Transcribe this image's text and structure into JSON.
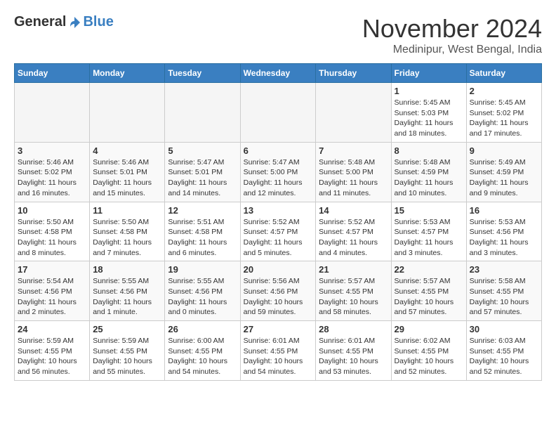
{
  "logo": {
    "general": "General",
    "blue": "Blue"
  },
  "title": "November 2024",
  "location": "Medinipur, West Bengal, India",
  "days_of_week": [
    "Sunday",
    "Monday",
    "Tuesday",
    "Wednesday",
    "Thursday",
    "Friday",
    "Saturday"
  ],
  "weeks": [
    [
      {
        "day": "",
        "info": ""
      },
      {
        "day": "",
        "info": ""
      },
      {
        "day": "",
        "info": ""
      },
      {
        "day": "",
        "info": ""
      },
      {
        "day": "",
        "info": ""
      },
      {
        "day": "1",
        "info": "Sunrise: 5:45 AM\nSunset: 5:03 PM\nDaylight: 11 hours and 18 minutes."
      },
      {
        "day": "2",
        "info": "Sunrise: 5:45 AM\nSunset: 5:02 PM\nDaylight: 11 hours and 17 minutes."
      }
    ],
    [
      {
        "day": "3",
        "info": "Sunrise: 5:46 AM\nSunset: 5:02 PM\nDaylight: 11 hours and 16 minutes."
      },
      {
        "day": "4",
        "info": "Sunrise: 5:46 AM\nSunset: 5:01 PM\nDaylight: 11 hours and 15 minutes."
      },
      {
        "day": "5",
        "info": "Sunrise: 5:47 AM\nSunset: 5:01 PM\nDaylight: 11 hours and 14 minutes."
      },
      {
        "day": "6",
        "info": "Sunrise: 5:47 AM\nSunset: 5:00 PM\nDaylight: 11 hours and 12 minutes."
      },
      {
        "day": "7",
        "info": "Sunrise: 5:48 AM\nSunset: 5:00 PM\nDaylight: 11 hours and 11 minutes."
      },
      {
        "day": "8",
        "info": "Sunrise: 5:48 AM\nSunset: 4:59 PM\nDaylight: 11 hours and 10 minutes."
      },
      {
        "day": "9",
        "info": "Sunrise: 5:49 AM\nSunset: 4:59 PM\nDaylight: 11 hours and 9 minutes."
      }
    ],
    [
      {
        "day": "10",
        "info": "Sunrise: 5:50 AM\nSunset: 4:58 PM\nDaylight: 11 hours and 8 minutes."
      },
      {
        "day": "11",
        "info": "Sunrise: 5:50 AM\nSunset: 4:58 PM\nDaylight: 11 hours and 7 minutes."
      },
      {
        "day": "12",
        "info": "Sunrise: 5:51 AM\nSunset: 4:58 PM\nDaylight: 11 hours and 6 minutes."
      },
      {
        "day": "13",
        "info": "Sunrise: 5:52 AM\nSunset: 4:57 PM\nDaylight: 11 hours and 5 minutes."
      },
      {
        "day": "14",
        "info": "Sunrise: 5:52 AM\nSunset: 4:57 PM\nDaylight: 11 hours and 4 minutes."
      },
      {
        "day": "15",
        "info": "Sunrise: 5:53 AM\nSunset: 4:57 PM\nDaylight: 11 hours and 3 minutes."
      },
      {
        "day": "16",
        "info": "Sunrise: 5:53 AM\nSunset: 4:56 PM\nDaylight: 11 hours and 3 minutes."
      }
    ],
    [
      {
        "day": "17",
        "info": "Sunrise: 5:54 AM\nSunset: 4:56 PM\nDaylight: 11 hours and 2 minutes."
      },
      {
        "day": "18",
        "info": "Sunrise: 5:55 AM\nSunset: 4:56 PM\nDaylight: 11 hours and 1 minute."
      },
      {
        "day": "19",
        "info": "Sunrise: 5:55 AM\nSunset: 4:56 PM\nDaylight: 11 hours and 0 minutes."
      },
      {
        "day": "20",
        "info": "Sunrise: 5:56 AM\nSunset: 4:56 PM\nDaylight: 10 hours and 59 minutes."
      },
      {
        "day": "21",
        "info": "Sunrise: 5:57 AM\nSunset: 4:55 PM\nDaylight: 10 hours and 58 minutes."
      },
      {
        "day": "22",
        "info": "Sunrise: 5:57 AM\nSunset: 4:55 PM\nDaylight: 10 hours and 57 minutes."
      },
      {
        "day": "23",
        "info": "Sunrise: 5:58 AM\nSunset: 4:55 PM\nDaylight: 10 hours and 57 minutes."
      }
    ],
    [
      {
        "day": "24",
        "info": "Sunrise: 5:59 AM\nSunset: 4:55 PM\nDaylight: 10 hours and 56 minutes."
      },
      {
        "day": "25",
        "info": "Sunrise: 5:59 AM\nSunset: 4:55 PM\nDaylight: 10 hours and 55 minutes."
      },
      {
        "day": "26",
        "info": "Sunrise: 6:00 AM\nSunset: 4:55 PM\nDaylight: 10 hours and 54 minutes."
      },
      {
        "day": "27",
        "info": "Sunrise: 6:01 AM\nSunset: 4:55 PM\nDaylight: 10 hours and 54 minutes."
      },
      {
        "day": "28",
        "info": "Sunrise: 6:01 AM\nSunset: 4:55 PM\nDaylight: 10 hours and 53 minutes."
      },
      {
        "day": "29",
        "info": "Sunrise: 6:02 AM\nSunset: 4:55 PM\nDaylight: 10 hours and 52 minutes."
      },
      {
        "day": "30",
        "info": "Sunrise: 6:03 AM\nSunset: 4:55 PM\nDaylight: 10 hours and 52 minutes."
      }
    ]
  ]
}
